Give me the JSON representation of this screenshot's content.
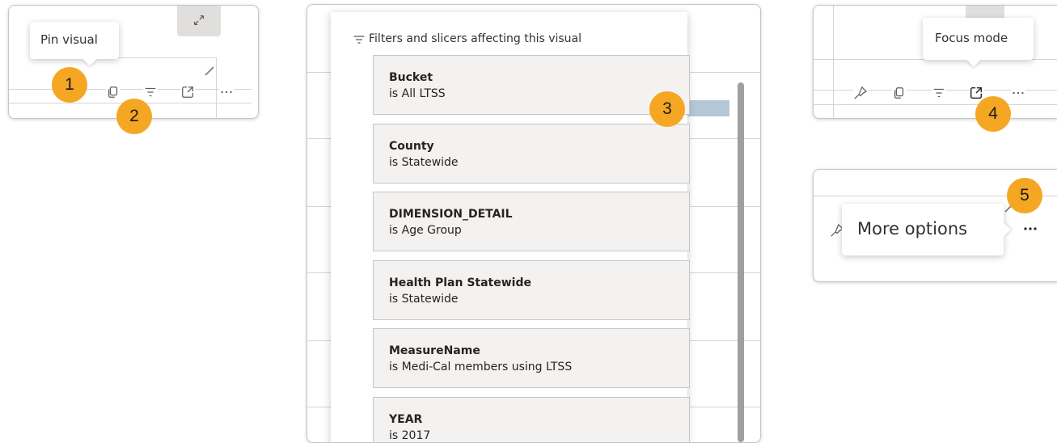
{
  "colors": {
    "badge": "#f5a623",
    "card_bg": "#f3f2f1",
    "card_border": "#c8c6c4",
    "scrollbar": "#a19f9d",
    "bar_fill": "#b3c7d6"
  },
  "badges": [
    "1",
    "2",
    "3",
    "4",
    "5"
  ],
  "panel1": {
    "tooltip": "Pin visual",
    "icons": [
      "expand-icon",
      "copy-icon",
      "filter-icon",
      "focus-mode-icon",
      "more-options-icon"
    ]
  },
  "panel2": {
    "header": "Filters and slicers affecting this visual",
    "filters": [
      {
        "name": "Bucket",
        "condition": "is All LTSS"
      },
      {
        "name": "County",
        "condition": "is Statewide"
      },
      {
        "name": "DIMENSION_DETAIL",
        "condition": "is Age Group"
      },
      {
        "name": "Health Plan Statewide",
        "condition": "is Statewide"
      },
      {
        "name": "MeasureName",
        "condition": "is Medi-Cal members using LTSS"
      },
      {
        "name": "YEAR",
        "condition": "is 2017"
      }
    ]
  },
  "panel3": {
    "tooltip": "Focus mode",
    "icons": [
      "pin-icon",
      "copy-icon",
      "filter-icon",
      "focus-mode-icon",
      "more-options-icon"
    ]
  },
  "panel4": {
    "tooltip": "More options",
    "icons": [
      "pin-icon",
      "more-options-icon"
    ]
  }
}
